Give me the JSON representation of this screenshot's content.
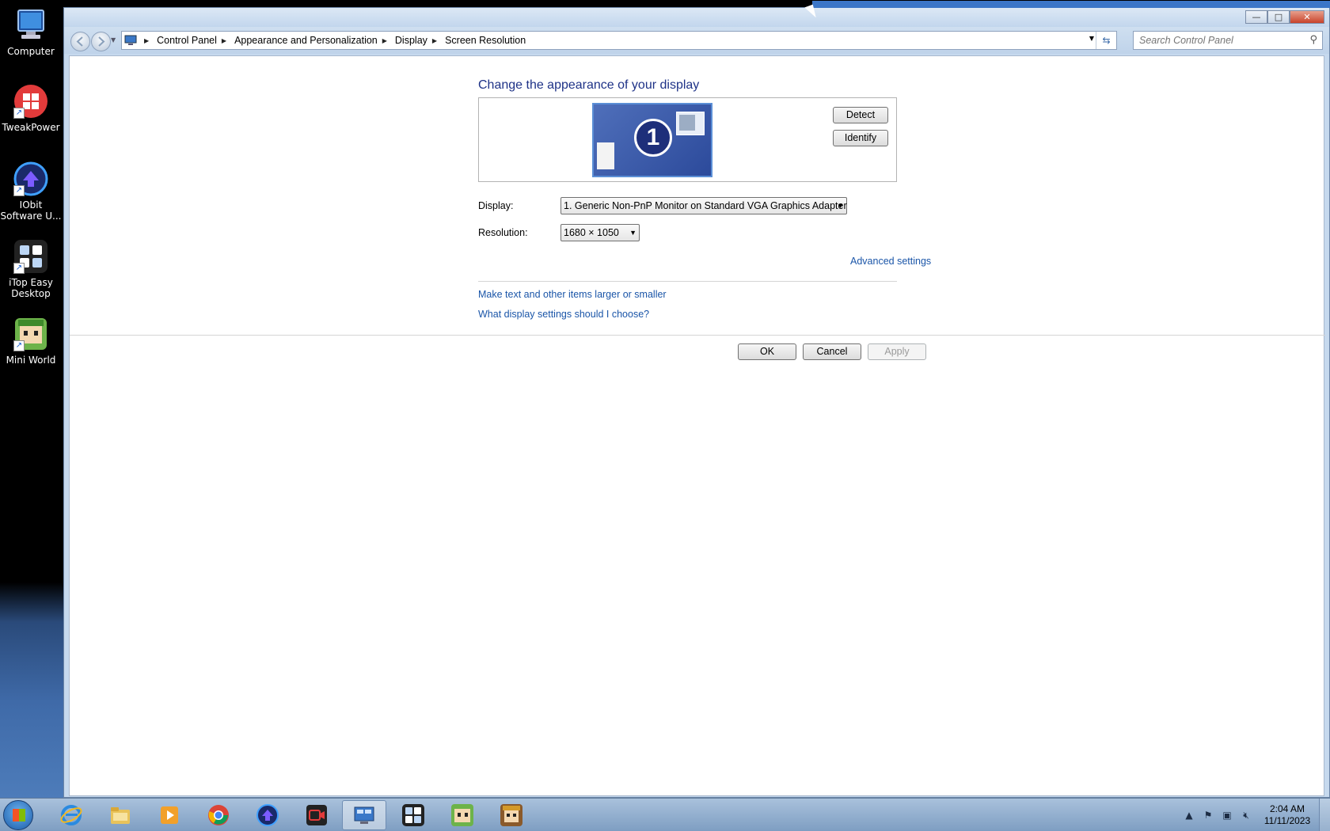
{
  "desktop": {
    "icons": [
      {
        "label": "Computer",
        "icon": "computer-icon"
      },
      {
        "label": "TweakPower",
        "icon": "tweakpower-icon"
      },
      {
        "label": "IObit Software U...",
        "icon": "iobit-icon"
      },
      {
        "label": "iTop Easy Desktop",
        "icon": "itop-easy-desktop-icon"
      },
      {
        "label": "Mini World",
        "icon": "mini-world-icon"
      }
    ]
  },
  "window": {
    "breadcrumb": [
      "Control Panel",
      "Appearance and Personalization",
      "Display",
      "Screen Resolution"
    ],
    "search_placeholder": "Search Control Panel",
    "controls": {
      "minimize": "—",
      "maximize": "□",
      "close": "✕"
    }
  },
  "main": {
    "heading": "Change the appearance of your display",
    "monitor_number": "1",
    "detect_label": "Detect",
    "identify_label": "Identify",
    "display_label": "Display:",
    "display_value": "1. Generic Non-PnP Monitor on Standard VGA Graphics Adapter",
    "resolution_label": "Resolution:",
    "resolution_value": "1680 × 1050",
    "advanced_link": "Advanced settings",
    "text_size_link": "Make text and other items larger or smaller",
    "help_link": "What display settings should I choose?",
    "ok_label": "OK",
    "cancel_label": "Cancel",
    "apply_label": "Apply"
  },
  "taskbar": {
    "items": [
      "internet-explorer-icon",
      "file-explorer-icon",
      "media-player-icon",
      "chrome-icon",
      "iobit-icon",
      "screen-recorder-icon",
      "control-panel-icon",
      "itop-easy-desktop-icon",
      "mini-world-icon",
      "mini-world-game-icon"
    ],
    "time": "2:04 AM",
    "date": "11/11/2023"
  },
  "colors": {
    "heading": "#1e3287",
    "link": "#1a55a8",
    "taskbar": "#8eaacb"
  }
}
